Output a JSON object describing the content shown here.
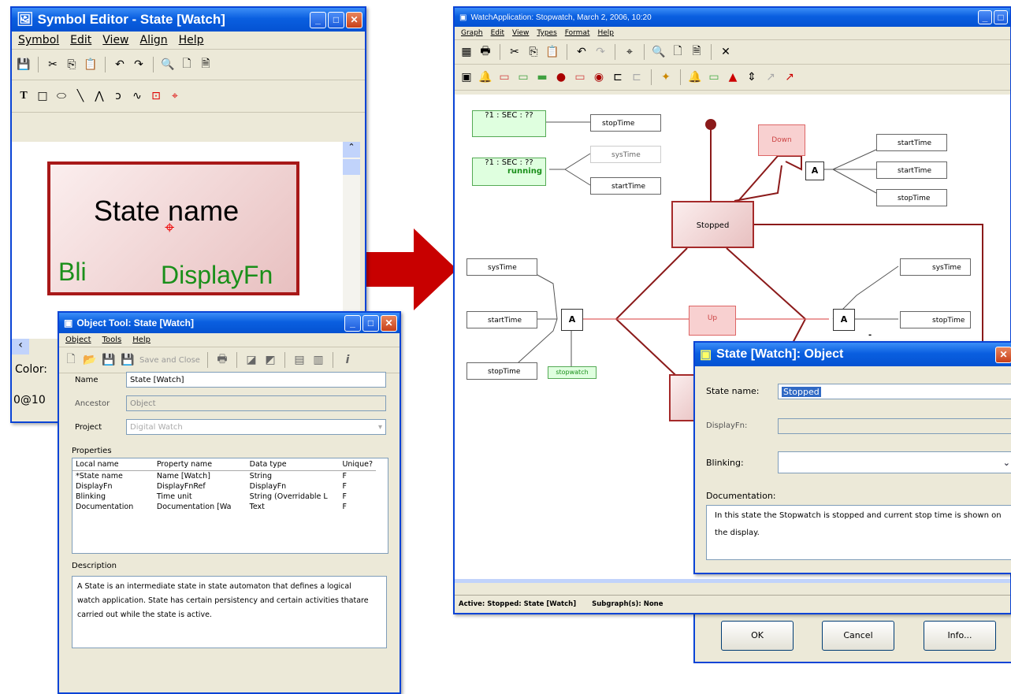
{
  "symbol_editor": {
    "title": "Symbol Editor - State [Watch]",
    "menu": [
      "Symbol",
      "Edit",
      "View",
      "Align",
      "Help"
    ],
    "state_name": "State name",
    "blink_label": "Bli",
    "display_fn": "DisplayFn",
    "color_label": "Color:",
    "status": "0@10"
  },
  "object_tool": {
    "title": "Object Tool: State [Watch]",
    "menu": [
      "Object",
      "Tools",
      "Help"
    ],
    "save_close": "Save and Close",
    "name_label": "Name",
    "name_value": "State [Watch]",
    "ancestor_label": "Ancestor",
    "ancestor_value": "Object",
    "project_label": "Project",
    "project_value": "Digital Watch",
    "properties_label": "Properties",
    "columns": [
      "Local name",
      "Property name",
      "Data type",
      "Unique?"
    ],
    "rows": [
      [
        "*State name",
        "Name [Watch]",
        "String",
        "F"
      ],
      [
        "DisplayFn",
        "DisplayFnRef",
        "DisplayFn",
        "F"
      ],
      [
        "Blinking",
        "Time unit",
        "String (Overridable L",
        "F"
      ],
      [
        "Documentation",
        "Documentation [Wa",
        "Text",
        "F"
      ]
    ],
    "description_label": "Description",
    "description_text": "A State is an intermediate state in state automaton that defines a logical watch application. State has certain persistency and certain activities thatare carried out while the state is active."
  },
  "graph_window": {
    "title": "WatchApplication: Stopwatch, March 2, 2006, 10:20",
    "menu": [
      "Graph",
      "Edit",
      "View",
      "Types",
      "Format",
      "Help"
    ],
    "status_active": "Active: Stopped: State [Watch]",
    "status_subgraph": "Subgraph(s): None",
    "nodes": {
      "sec1": "?1 : SEC : ??",
      "sec2": "?1 : SEC : ??",
      "running": "running",
      "stoptime_top": "stopTime",
      "systime_top": "sysTime",
      "starttime_top": "startTime",
      "down": "Down",
      "a": "A",
      "starttime_r1": "startTime",
      "starttime_r2": "startTime",
      "stoptime_r": "stopTime",
      "stopped": "Stopped",
      "systime_left": "sysTime",
      "starttime_left": "startTime",
      "stoptime_left": "stopTime",
      "stopwatch": "stopwatch",
      "up": "Up",
      "systime_right": "sysTime",
      "stoptime_right": "stopTime",
      "dash": "-"
    }
  },
  "state_dialog": {
    "title": "State [Watch]: Object",
    "state_name_label": "State name:",
    "state_name_value": "Stopped",
    "displayfn_label": "DisplayFn:",
    "blinking_label": "Blinking:",
    "documentation_label": "Documentation:",
    "documentation_text": "In this state the Stopwatch is stopped and current stop time is shown on the display.",
    "ok": "OK",
    "cancel": "Cancel",
    "info": "Info..."
  },
  "colors": {
    "accent_red": "#c00000",
    "state_border": "#a52a2a",
    "green_node": "#1a8f1a"
  }
}
